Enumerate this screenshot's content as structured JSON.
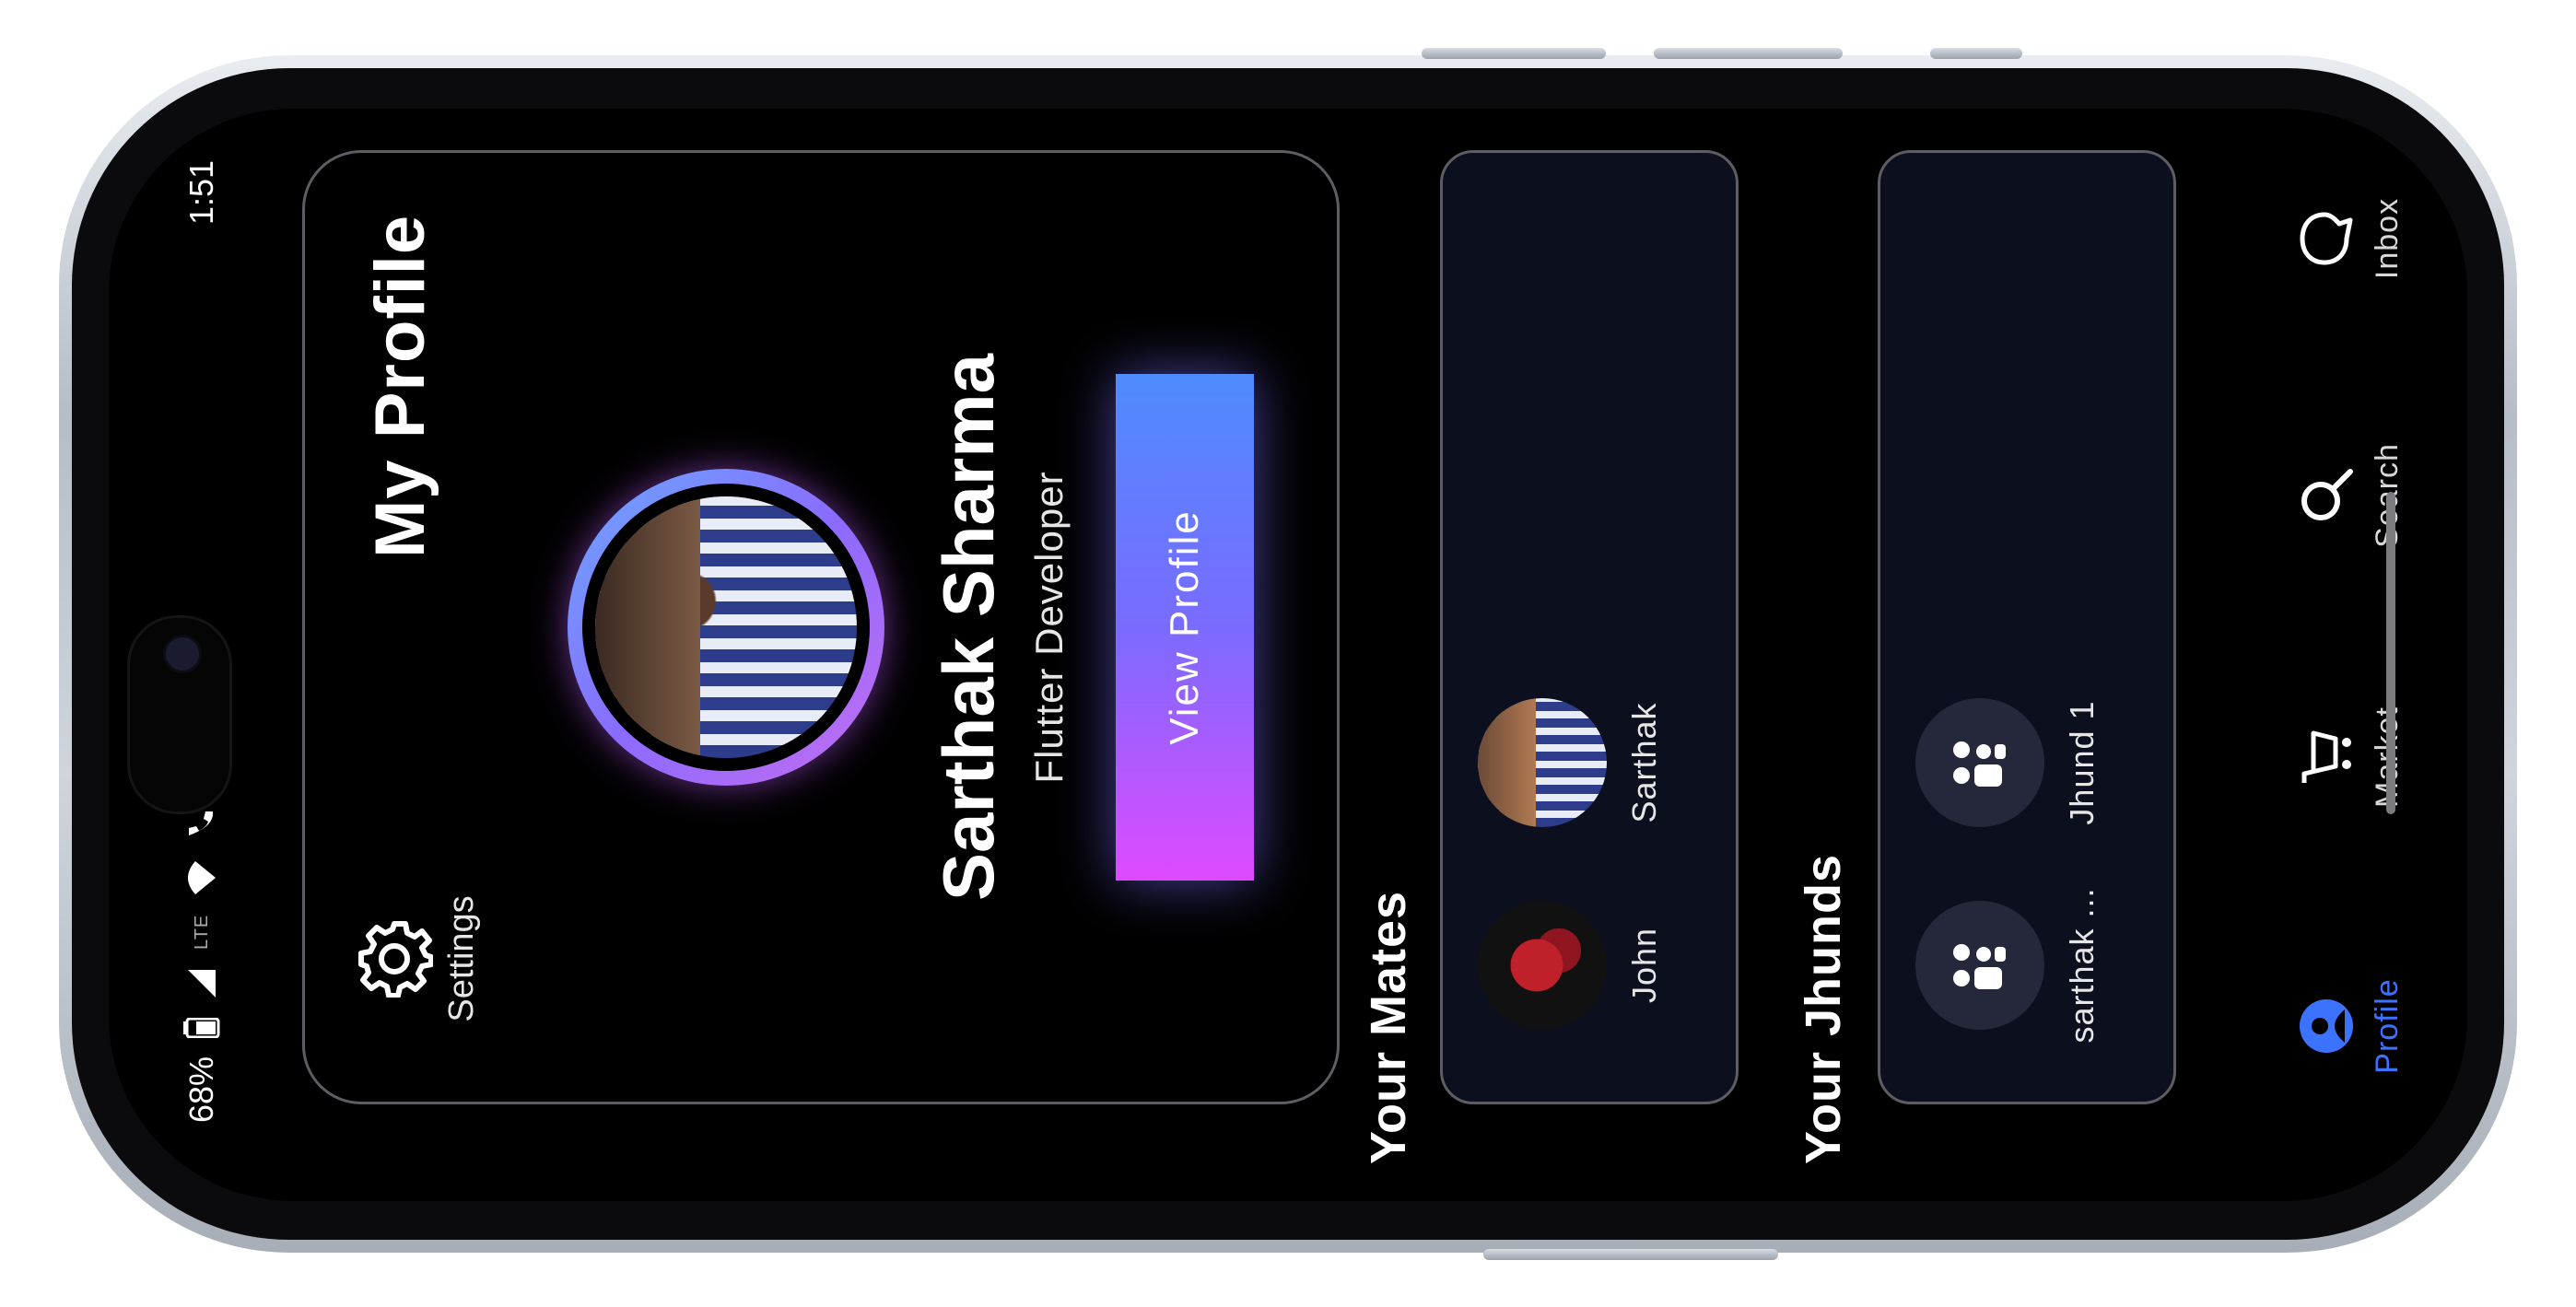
{
  "status_bar": {
    "time": "1:51",
    "network": "LTE",
    "battery": "68%"
  },
  "profile": {
    "title": "My Profile",
    "settings_label": "Settings",
    "name": "Sarthak Sharma",
    "role": "Flutter Developer",
    "view_button": "View Profile"
  },
  "mates": {
    "title": "Your Mates",
    "items": [
      {
        "name": "John"
      },
      {
        "name": "Sarthak"
      }
    ]
  },
  "jhunds": {
    "title": "Your Jhunds",
    "items": [
      {
        "name": "sarthak ..."
      },
      {
        "name": "Jhund 1"
      }
    ]
  },
  "nav": {
    "items": [
      {
        "label": "Inbox",
        "icon": "chat-bubble-icon"
      },
      {
        "label": "Search",
        "icon": "search-icon"
      },
      {
        "label": "Market",
        "icon": "cart-icon"
      },
      {
        "label": "Profile",
        "icon": "profile-icon",
        "active": true
      }
    ]
  },
  "colors": {
    "accent": "#3b73ff",
    "button_gradient": [
      "#df4aff",
      "#4f8bff"
    ],
    "card_bg": "#0b0f1e"
  }
}
